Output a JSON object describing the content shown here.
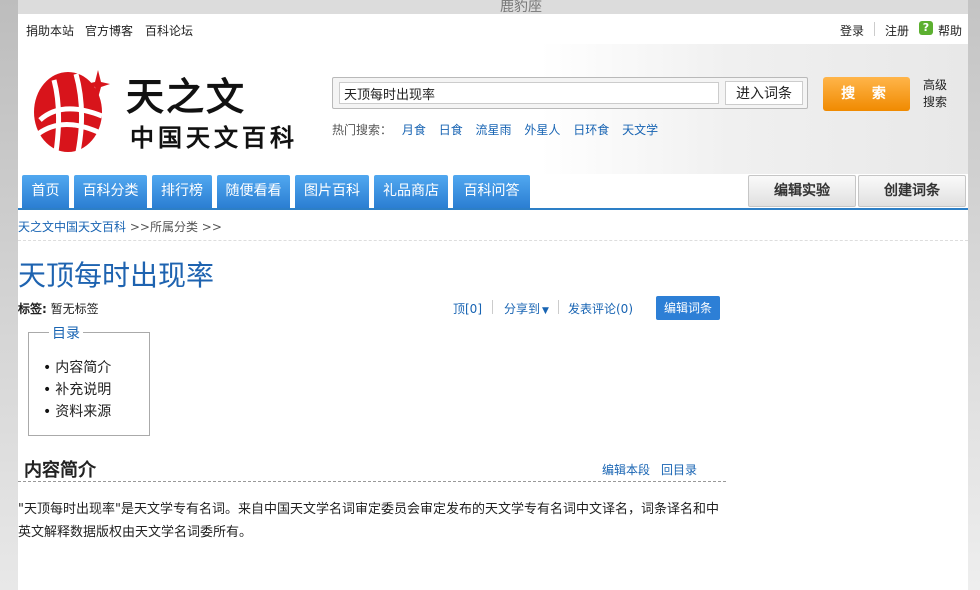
{
  "background": {
    "top_text": "鹿豹座"
  },
  "topbar": {
    "left_links": [
      "捐助本站",
      "官方博客",
      "百科论坛"
    ],
    "login": "登录",
    "register": "注册",
    "help_icon": "?",
    "help": "帮助"
  },
  "logo": {
    "title": "天之文",
    "subtitle": "中国天文百科"
  },
  "search": {
    "value": "天顶每时出现率",
    "enter_label": "进入词条",
    "search_label": "搜 索",
    "advanced": "高级搜索",
    "hot_label": "热门搜索：",
    "hot_words": [
      "月食",
      "日食",
      "流星雨",
      "外星人",
      "日环食",
      "天文学"
    ]
  },
  "nav": {
    "tabs": [
      "首页",
      "百科分类",
      "排行榜",
      "随便看看",
      "图片百科",
      "礼品商店",
      "百科问答"
    ],
    "edit_lab": "编辑实验",
    "create_entry": "创建词条"
  },
  "breadcrumb": {
    "home": "天之文中国天文百科",
    "sep1": " >>",
    "category": "所属分类",
    "sep2": " >>"
  },
  "article": {
    "title": "天顶每时出现率",
    "tags_label": "标签:",
    "tags_value": "暂无标签",
    "top_count": "顶[0]",
    "share": "分享到",
    "comment": "发表评论(0)",
    "edit_entry": "编辑词条"
  },
  "toc": {
    "title": "目录",
    "items": [
      "内容简介",
      "补充说明",
      "资料来源"
    ]
  },
  "section": {
    "title": "内容简介",
    "edit": "编辑本段",
    "back": "回目录",
    "body": "\"天顶每时出现率\"是天文学专有名词。来自中国天文学名词审定委员会审定发布的天文学专有名词中文译名，词条译名和中英文解释数据版权由天文学名词委所有。"
  },
  "colors": {
    "brand_blue": "#2d7fd6",
    "link_blue": "#1864b3",
    "search_orange": "#f08a00",
    "logo_red": "#d8141b"
  }
}
